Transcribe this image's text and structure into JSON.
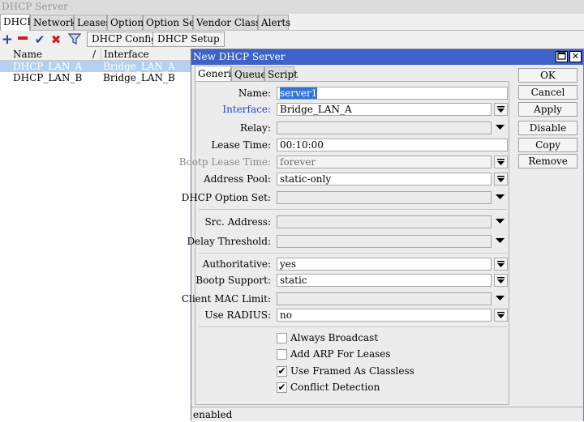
{
  "window": {
    "title": "DHCP Server"
  },
  "tabs": [
    "DHCP",
    "Networks",
    "Leases",
    "Options",
    "Option Sets",
    "Vendor Classes",
    "Alerts"
  ],
  "toolbar": {
    "icons": [
      "add-icon",
      "remove-icon",
      "enable-icon",
      "disable-icon",
      "filter-icon"
    ],
    "dhcp_config": "DHCP Config",
    "dhcp_setup": "DHCP Setup"
  },
  "list": {
    "columns": {
      "name": "Name",
      "sort": "/",
      "interface": "Interface"
    },
    "rows": [
      {
        "name": "DHCP_LAN_A",
        "interface": "Bridge_LAN_A"
      },
      {
        "name": "DHCP_LAN_B",
        "interface": "Bridge_LAN_B"
      }
    ]
  },
  "dialog": {
    "title": "New DHCP Server",
    "tabs": [
      "Generic",
      "Queues",
      "Script"
    ],
    "fields": {
      "name": {
        "label": "Name:",
        "value": "server1"
      },
      "interface": {
        "label": "Interface:",
        "value": "Bridge_LAN_A"
      },
      "relay": {
        "label": "Relay:",
        "value": ""
      },
      "lease_time": {
        "label": "Lease Time:",
        "value": "00:10:00"
      },
      "bootp_lease_time": {
        "label": "Bootp Lease Time:",
        "value": "forever"
      },
      "address_pool": {
        "label": "Address Pool:",
        "value": "static-only"
      },
      "dhcp_option_set": {
        "label": "DHCP Option Set:",
        "value": ""
      },
      "src_address": {
        "label": "Src. Address:",
        "value": ""
      },
      "delay_threshold": {
        "label": "Delay Threshold:",
        "value": ""
      },
      "authoritative": {
        "label": "Authoritative:",
        "value": "yes"
      },
      "bootp_support": {
        "label": "Bootp Support:",
        "value": "static"
      },
      "client_mac_limit": {
        "label": "Client MAC Limit:",
        "value": ""
      },
      "use_radius": {
        "label": "Use RADIUS:",
        "value": "no"
      }
    },
    "checkboxes": [
      {
        "label": "Always Broadcast",
        "checked": false
      },
      {
        "label": "Add ARP For Leases",
        "checked": false
      },
      {
        "label": "Use Framed As Classless",
        "checked": true
      },
      {
        "label": "Conflict Detection",
        "checked": true
      }
    ],
    "buttons": {
      "ok": "OK",
      "cancel": "Cancel",
      "apply": "Apply",
      "disable": "Disable",
      "copy": "Copy",
      "remove": "Remove"
    },
    "status": "enabled"
  },
  "colors": {
    "titlebar": "#3d63c9",
    "selected_row": "#b3d0f2",
    "interface_label": "#2a3fd2",
    "remove_icon": "#d11a1a",
    "add_icon": "#1f3fbf"
  }
}
